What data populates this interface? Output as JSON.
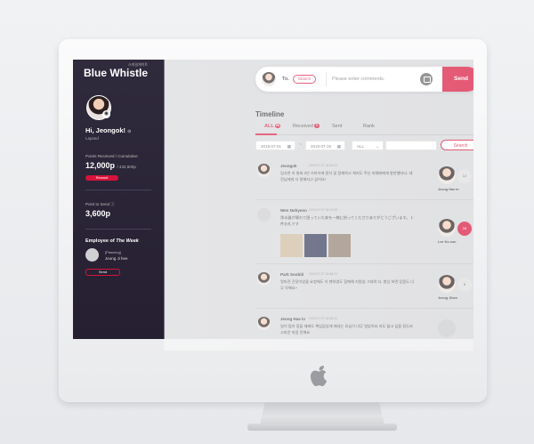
{
  "sidebar": {
    "logo": "Blue Whistle",
    "logo_sub": "스마일게이트",
    "greeting": "Hi, Jeongok!",
    "role": "Lapsed",
    "points_label": "Points Received / Cumulative",
    "points_value": "12,000p",
    "points_cumulative": "/ 432,500p",
    "reward_label": "Reward",
    "send_points_label": "Point to Send",
    "send_points_value": "3,600p",
    "employee_of_week_prefix": "Employee of ",
    "employee_of_week_em": "The Week",
    "employee_dept": "[Planning]",
    "employee_name": "Jeong Ji hee",
    "employee_button": "Send"
  },
  "compose": {
    "to_label": "To.",
    "search_label": "Search",
    "placeholder": "Please enter comments.",
    "send_label": "Send"
  },
  "timeline": {
    "title": "Timeline",
    "tabs": [
      {
        "label": "ALL",
        "count": "99"
      },
      {
        "label": "Received",
        "count": "5"
      },
      {
        "label": "Sent",
        "count": ""
      },
      {
        "label": "Rank",
        "count": ""
      }
    ],
    "date_from": "2019-07-01",
    "date_to": "2019-07-15",
    "select_value": "ALL",
    "search_label": "Search"
  },
  "posts": [
    {
      "name": "Jeongok",
      "date": "2019.07.07 18:45:21",
      "body": "업사한 지 벌써 3년 가까이에 원치 및 함께하고 계지도 주신 미례배에게 항한했더다. 대전님에게 더 잘해지고 싶어요!",
      "recipient": "Jeong Hae in",
      "side": "12"
    },
    {
      "name": "Wen Nohyeon",
      "date": "2019.07.07 16:12:03",
      "body": "净水器が壊れて困っていた本を一緒に拾ってくださりありがとうございます。 1件お礼です",
      "recipient": "Lee Ko eun",
      "side": "26"
    },
    {
      "name": "Park Soobiti",
      "date": "2019.07.07 15:46:21",
      "body": "얼마전 간장이었을 요청해도 이 팬하였도 함께해 지원실 그대의 다. 항상 보면 믿음도 너무 악해요~",
      "recipient": "Jeong Jihee",
      "side": "5"
    },
    {
      "name": "Jeong Hae in",
      "date": "2019.07.07 18:45:21",
      "body": "일이 많아 힘들 때에도 책임감있게 해내는 모습이 너무 멋있어요 저도 닮고 싶을 정도라 고마운 마음 전해요",
      "recipient": "",
      "side": ""
    }
  ],
  "colors": {
    "accent": "#d8123a",
    "sidebar_bg": "#2b2638"
  }
}
